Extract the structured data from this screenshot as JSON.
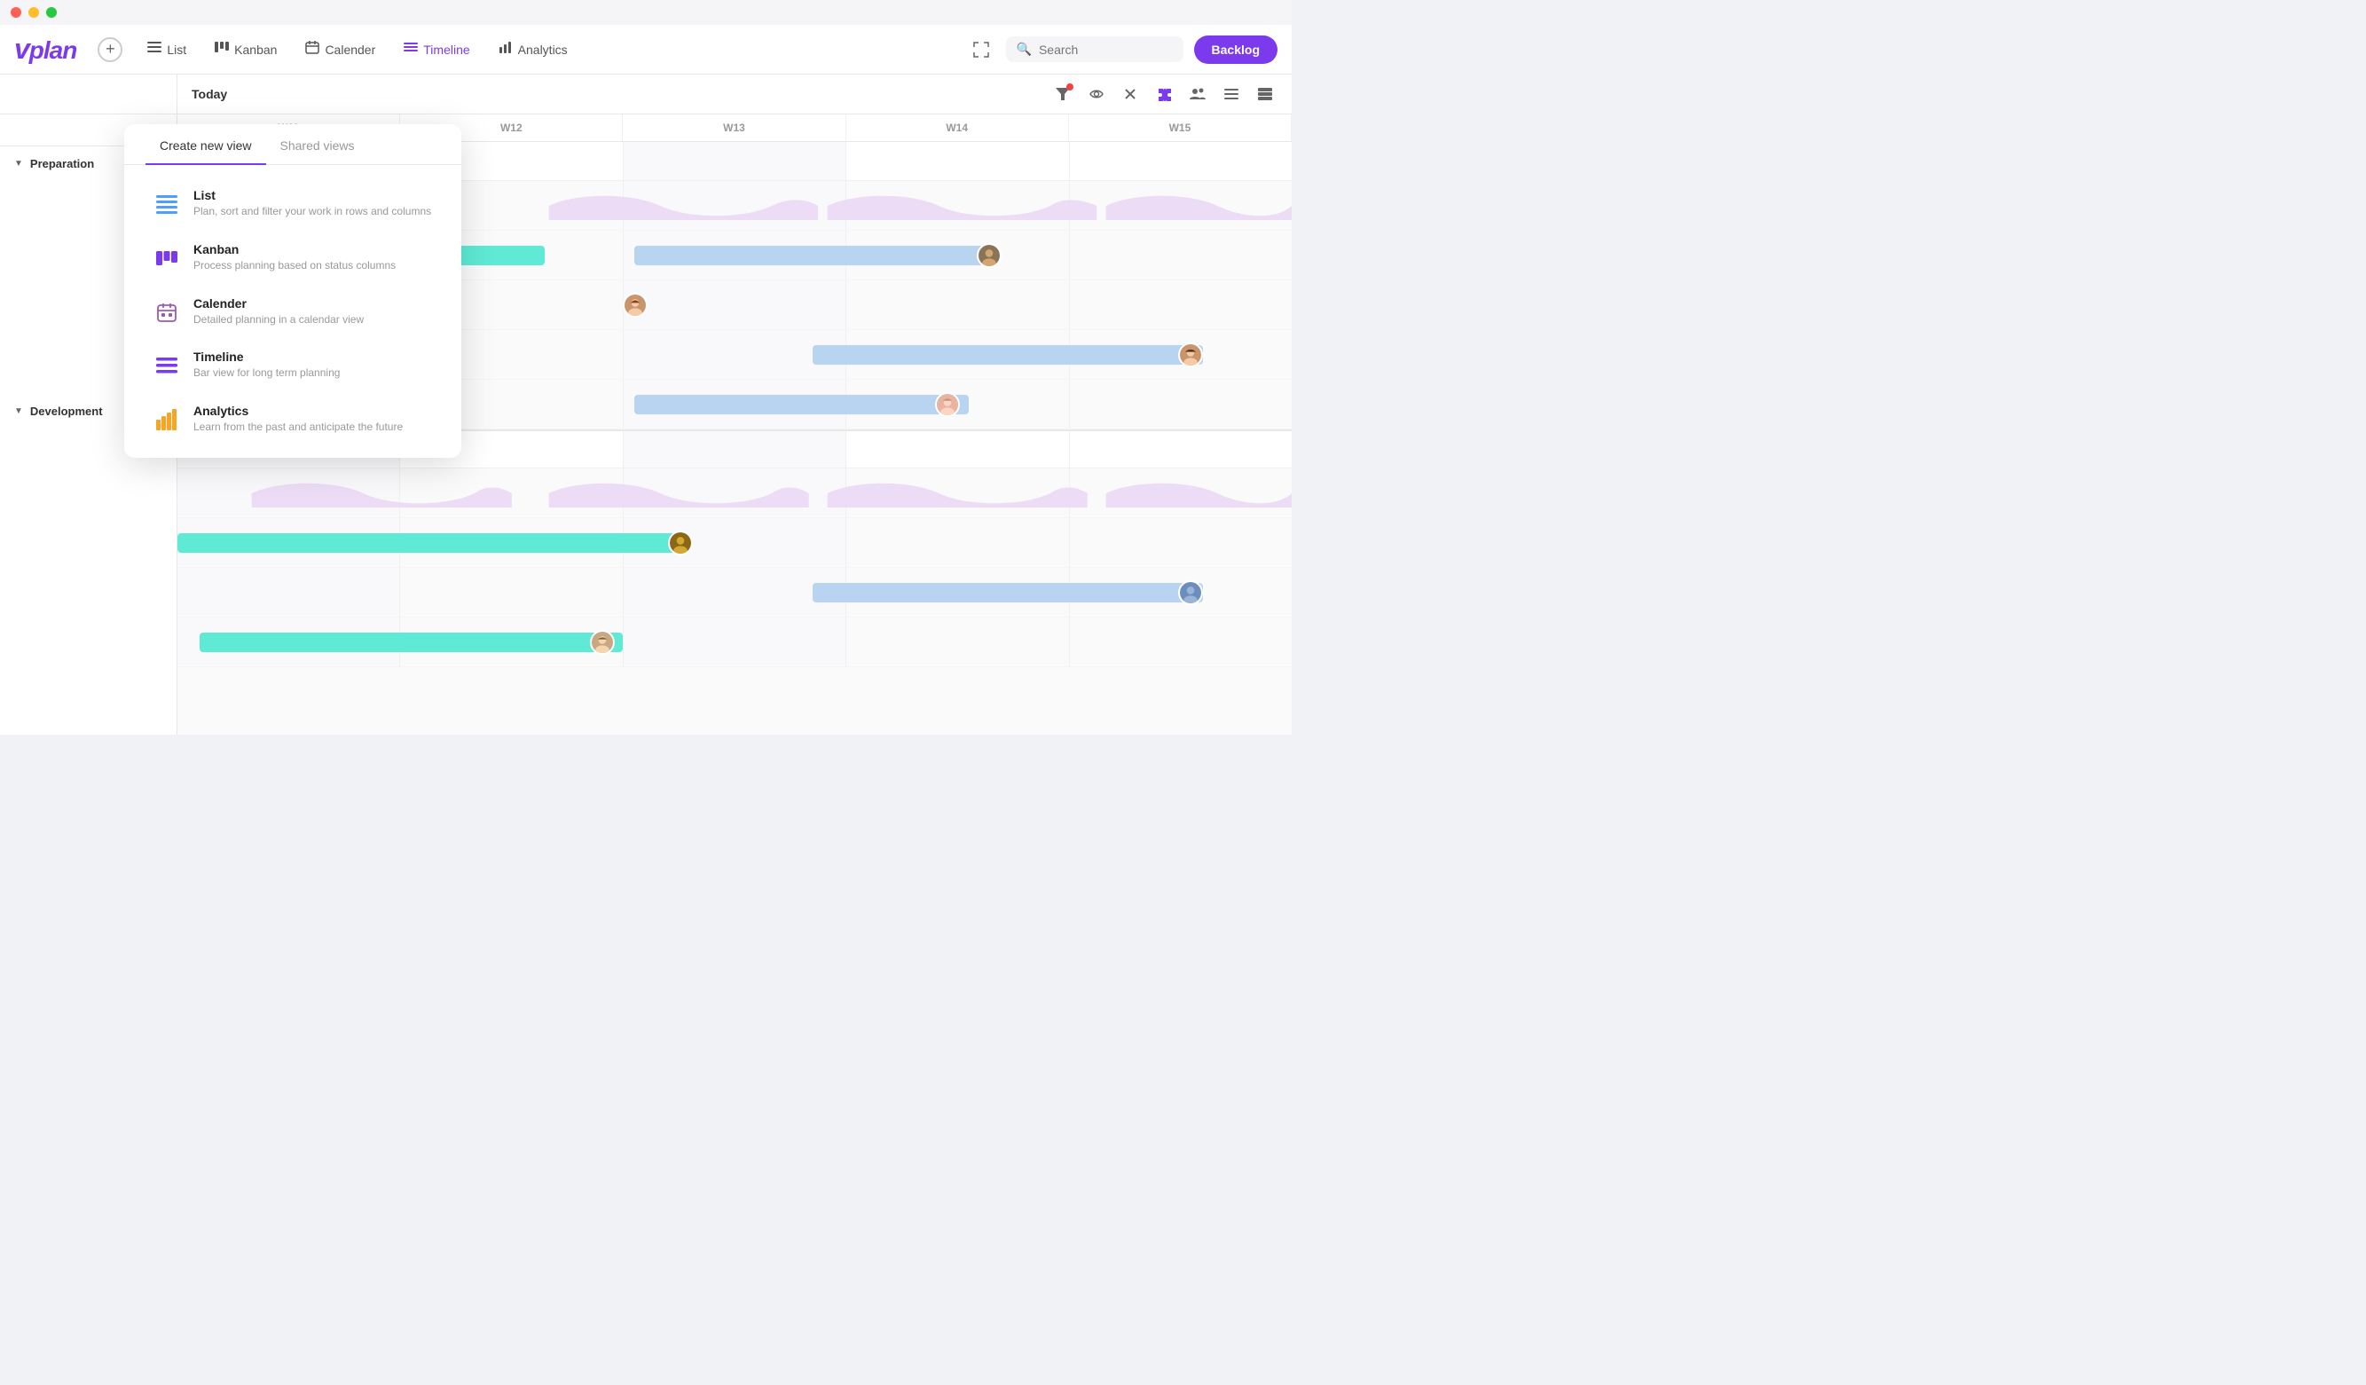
{
  "window": {
    "title": "Vplan"
  },
  "navbar": {
    "logo": "vplan",
    "add_label": "+",
    "tabs": [
      {
        "id": "list",
        "label": "List",
        "icon": "≡",
        "active": false
      },
      {
        "id": "kanban",
        "label": "Kanban",
        "icon": "⊞",
        "active": false
      },
      {
        "id": "calender",
        "label": "Calender",
        "icon": "📅",
        "active": false
      },
      {
        "id": "timeline",
        "label": "Timeline",
        "icon": "☰",
        "active": true
      },
      {
        "id": "analytics",
        "label": "Analytics",
        "icon": "📊",
        "active": false
      }
    ],
    "search_placeholder": "Search",
    "backlog_label": "Backlog",
    "fullscreen_icon": "⤢"
  },
  "toolbar": {
    "today_label": "Today",
    "icons": [
      "filter",
      "eye",
      "x",
      "puzzle",
      "people",
      "list",
      "stack"
    ]
  },
  "week_headers": [
    "W11",
    "W12",
    "W13",
    "W14",
    "W15"
  ],
  "sections": [
    {
      "id": "preparation",
      "label": "Preparation",
      "collapsed": false
    },
    {
      "id": "development",
      "label": "Development",
      "collapsed": false
    }
  ],
  "dropdown": {
    "tabs": [
      {
        "id": "create",
        "label": "Create new view",
        "active": true
      },
      {
        "id": "shared",
        "label": "Shared views",
        "active": false
      }
    ],
    "items": [
      {
        "id": "list",
        "title": "List",
        "description": "Plan, sort and filter your work in rows and columns",
        "icon_type": "list",
        "icon_color": "#4f9ef8"
      },
      {
        "id": "kanban",
        "title": "Kanban",
        "description": "Process planning based on status columns",
        "icon_type": "kanban",
        "icon_color": "#7c3aed"
      },
      {
        "id": "calender",
        "title": "Calender",
        "description": "Detailed planning in a calendar view",
        "icon_type": "calendar",
        "icon_color": "#9b59b6"
      },
      {
        "id": "timeline",
        "title": "Timeline",
        "description": "Bar view for long term planning",
        "icon_type": "timeline",
        "icon_color": "#7c3aed"
      },
      {
        "id": "analytics",
        "title": "Analytics",
        "description": "Learn from the past and anticipate the future",
        "icon_type": "analytics",
        "icon_color": "#f5a623"
      }
    ]
  }
}
